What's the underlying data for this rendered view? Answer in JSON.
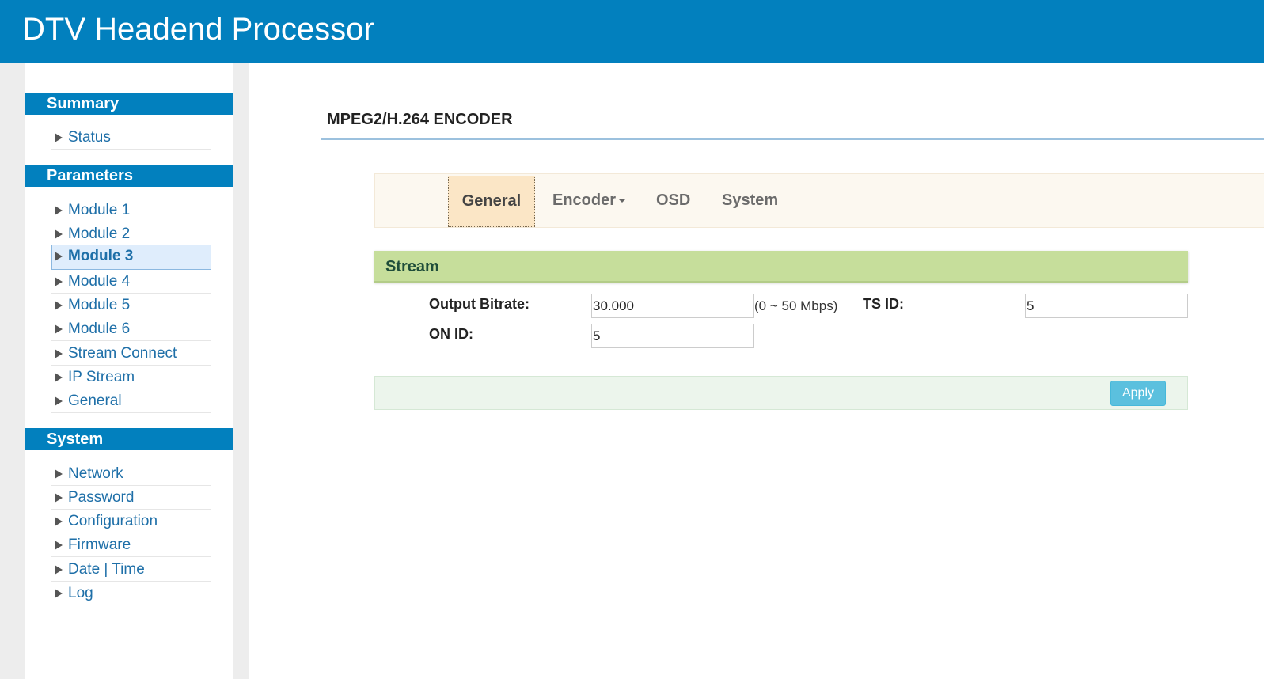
{
  "header": {
    "title": "DTV Headend Processor"
  },
  "sidebar": {
    "summary": {
      "title": "Summary",
      "items": [
        {
          "label": "Status"
        }
      ]
    },
    "parameters": {
      "title": "Parameters",
      "items": [
        {
          "label": "Module 1"
        },
        {
          "label": "Module 2"
        },
        {
          "label": "Module 3",
          "active": true
        },
        {
          "label": "Module 4"
        },
        {
          "label": "Module 5"
        },
        {
          "label": "Module 6"
        },
        {
          "label": "Stream Connect"
        },
        {
          "label": "IP Stream"
        },
        {
          "label": "General"
        }
      ]
    },
    "system": {
      "title": "System",
      "items": [
        {
          "label": "Network"
        },
        {
          "label": "Password"
        },
        {
          "label": "Configuration"
        },
        {
          "label": "Firmware"
        },
        {
          "label": "Date | Time"
        },
        {
          "label": "Log"
        }
      ]
    }
  },
  "main": {
    "page_title": "MPEG2/H.264 ENCODER",
    "tabs": [
      {
        "label": "General",
        "active": true
      },
      {
        "label": "Encoder",
        "dropdown": true
      },
      {
        "label": "OSD"
      },
      {
        "label": "System"
      }
    ],
    "stream": {
      "title": "Stream",
      "output_bitrate": {
        "label": "Output Bitrate:",
        "value": "30.000",
        "hint": "(0 ~ 50 Mbps)"
      },
      "ts_id": {
        "label": "TS ID:",
        "value": "5"
      },
      "on_id": {
        "label": "ON ID:",
        "value": "5"
      }
    },
    "apply_label": "Apply"
  },
  "colors": {
    "header_bg": "#0280be",
    "section_head_bg": "#0280be",
    "nav_link": "#1e6fa8",
    "stream_panel_bg": "#c6de9b",
    "active_tab_bg": "#fbe6c6",
    "apply_button_bg": "#5bc0de"
  },
  "icons": {
    "nav_bullet": "triangle-right-icon",
    "dropdown": "caret-down-icon"
  }
}
